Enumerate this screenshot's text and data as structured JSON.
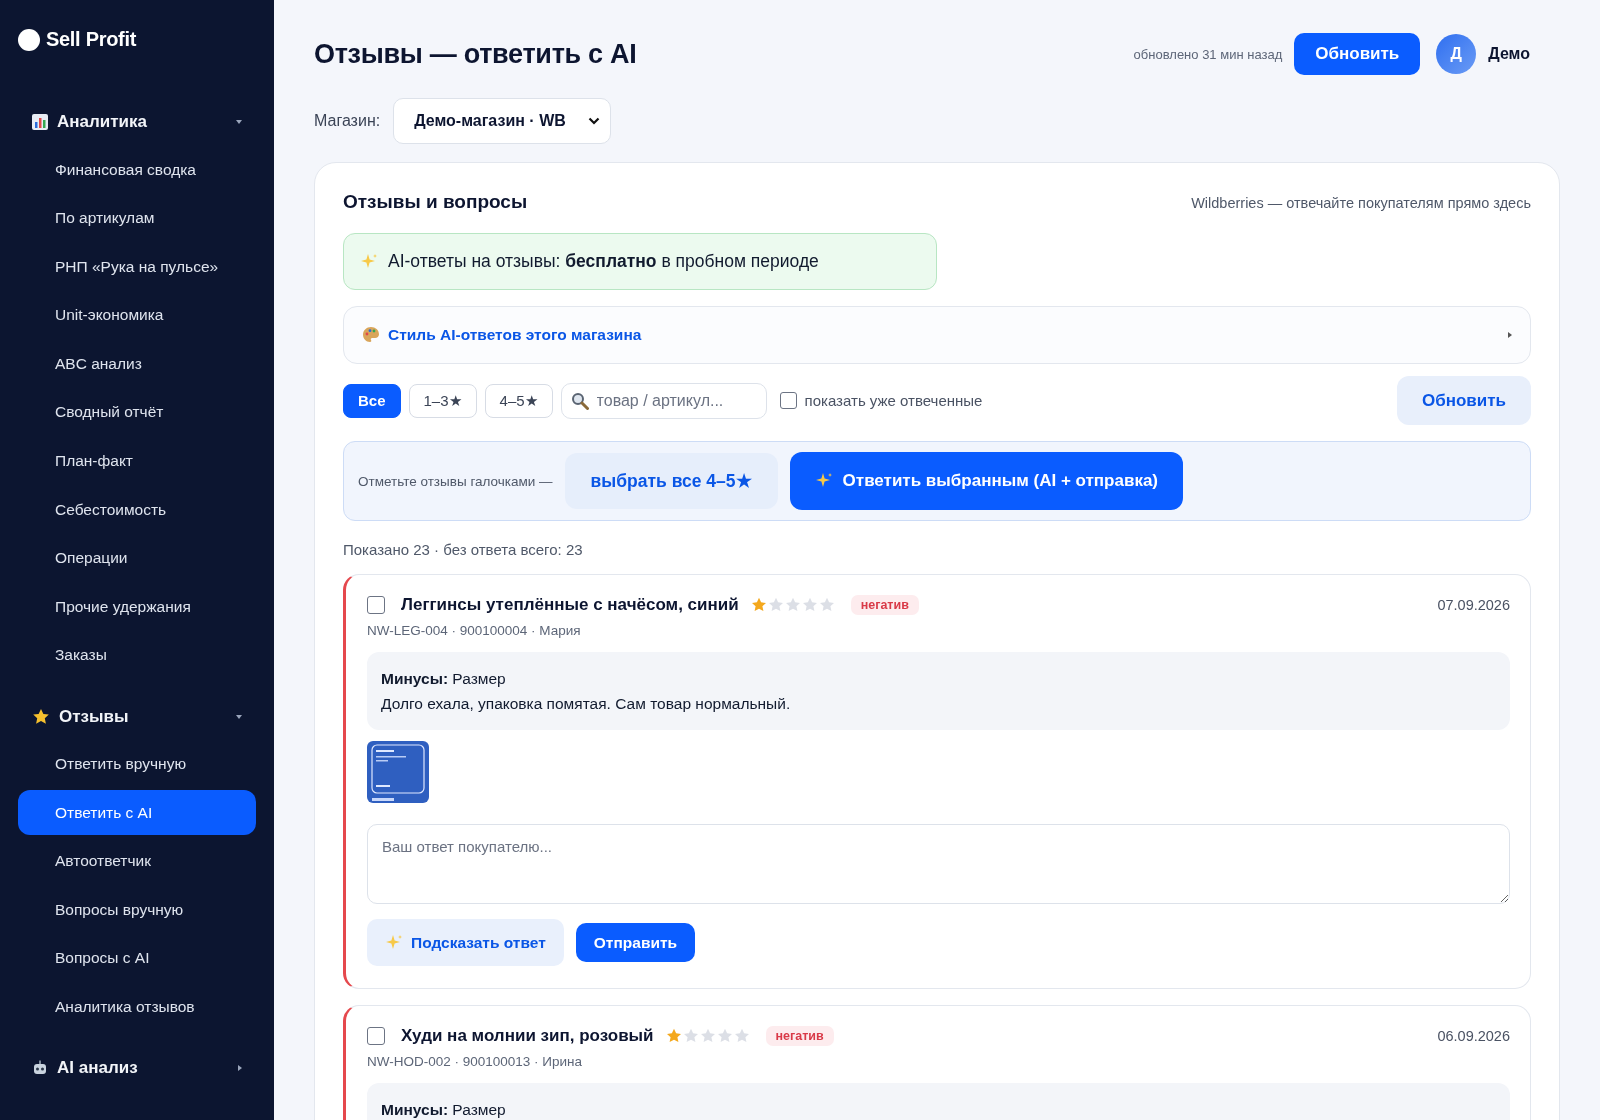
{
  "brand": "Sell Profit",
  "sidebar": {
    "sections": [
      {
        "label": "Аналитика",
        "expanded": true,
        "items": [
          {
            "label": "Финансовая сводка",
            "selected": false
          },
          {
            "label": "По артикулам",
            "selected": false
          },
          {
            "label": "РНП «Рука на пульсе»",
            "selected": false
          },
          {
            "label": "Unit-экономика",
            "selected": false
          },
          {
            "label": "ABC анализ",
            "selected": false
          },
          {
            "label": "Сводный отчёт",
            "selected": false
          },
          {
            "label": "План-факт",
            "selected": false
          },
          {
            "label": "Себестоимость",
            "selected": false
          },
          {
            "label": "Операции",
            "selected": false
          },
          {
            "label": "Прочие удержания",
            "selected": false
          },
          {
            "label": "Заказы",
            "selected": false
          }
        ]
      },
      {
        "label": "Отзывы",
        "expanded": true,
        "items": [
          {
            "label": "Ответить вручную",
            "selected": false
          },
          {
            "label": "Ответить с AI",
            "selected": true
          },
          {
            "label": "Автоответчик",
            "selected": false
          },
          {
            "label": "Вопросы вручную",
            "selected": false
          },
          {
            "label": "Вопросы с AI",
            "selected": false
          },
          {
            "label": "Аналитика отзывов",
            "selected": false
          }
        ]
      },
      {
        "label": "AI анализ",
        "expanded": false
      }
    ]
  },
  "header": {
    "title": "Отзывы — ответить с AI",
    "updated": "обновлено 31 мин назад",
    "refresh_button": "Обновить",
    "user": {
      "initial": "Д",
      "name": "Демо"
    }
  },
  "store": {
    "label": "Магазин:",
    "value": "Демо-магазин · WB"
  },
  "panel": {
    "title": "Отзывы и вопросы",
    "subtitle": "Wildberries — отвечайте покупателям прямо здесь",
    "promo": "AI-ответы на отзывы: **бесплатно** в пробном периоде",
    "style_section": {
      "label": "Стиль AI-ответов этого магазина",
      "expanded": false
    },
    "filters": [
      {
        "label": "Все",
        "selected": true
      },
      {
        "label": "1–3★",
        "selected": false
      },
      {
        "label": "4–5★",
        "selected": false
      }
    ],
    "search": {
      "placeholder": "товар / артикул..."
    },
    "show_answered": {
      "label": "показать уже отвеченные",
      "checked": false
    },
    "refresh_button": "Обновить",
    "bulk": {
      "hint": "Отметьте отзывы галочками —",
      "select_button": "выбрать все 4–5★",
      "reply_button": "Ответить выбранным (AI + отправка)"
    },
    "summary": "Показано 23 · без ответа всего: 23",
    "reviews": [
      {
        "checked": false,
        "product": "Леггинсы утеплённые с начёсом, синий",
        "stars": 1,
        "badge": "негатив",
        "date": "07.09.2026",
        "meta": "NW-LEG-004 · 900100004 · Мария",
        "cons": "**Минусы:** Размер",
        "text": "Долго ехала, упаковка помятая. Сам товар нормальный.",
        "photos": [
          {
            "kind": "picture"
          }
        ],
        "reply": {
          "placeholder": "Ваш ответ покупателю..."
        },
        "suggest_button": "Подсказать ответ",
        "send_button": "Отправить"
      },
      {
        "checked": false,
        "product": "Худи на молнии зип, розовый",
        "stars": 1,
        "badge": "негатив",
        "date": "06.09.2026",
        "meta": "NW-HOD-002 · 900100013 · Ирина",
        "cons": "**Минусы:** Размер"
      }
    ]
  }
}
